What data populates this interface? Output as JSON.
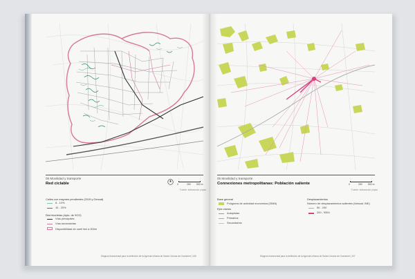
{
  "left_page": {
    "section": "05 Movilidad y transporte",
    "title": "Red ciclable",
    "scale": [
      "0",
      "250",
      "500 m"
    ],
    "credit": "Fuente: elaboración propia",
    "legend": {
      "slopes_title": "Calles con mayores pendientes (2019 y Gencat)",
      "slopes": [
        "8 - 10%",
        "10 - 20%"
      ],
      "bike_title": "Red bicicletas (Ayto. de SCO)",
      "bike": [
        "Vías principales",
        "Vías secundarias",
        "Disponibilidad de carril bici a 300m"
      ]
    },
    "colors": {
      "slope_1": "#7fc7a4",
      "slope_2": "#2f8a68",
      "bike_main": "#333333",
      "bike_secondary": "#c87aa0",
      "availability": "#d7779a"
    },
    "footer": "Diagnosi transversal para la definición de la Agenda Urbana de Santa Coloma de Gramenet | 106"
  },
  "right_page": {
    "section": "05 Movilidad y transporte",
    "title": "Connexiones metropolitanas: Población saliente",
    "scale": [
      "0",
      "250",
      "500 m"
    ],
    "credit": "Fuente: elaboración propia",
    "legend": {
      "base_title": "Base general",
      "base_item": "Polígonos de actividad económica (SIMA)",
      "roads_title": "Ejes viarios",
      "roads": [
        "Autopistas",
        "Primarios",
        "Secundarios"
      ],
      "flows_title": "Desplazamientos",
      "flows_sub": "Número de desplazamientos salientes (Idescat, INE)",
      "flows": [
        "50 - 200",
        "200 - 9394"
      ]
    },
    "colors": {
      "polygon": "#c8d65a",
      "flow_low": "#e58fb4",
      "flow_high": "#d9407f"
    },
    "footer": "Diagnosi transversal para la definición de la Agenda Urbana de Santa Coloma de Gramenet | 107"
  }
}
